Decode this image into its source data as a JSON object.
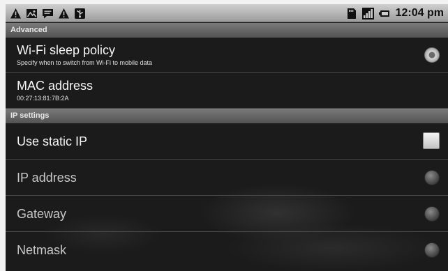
{
  "status_bar": {
    "left_icons": [
      "warning-icon",
      "image-icon",
      "message-icon",
      "warning-icon",
      "usb-icon"
    ],
    "right_icons": [
      "sd-card-icon",
      "signal-icon",
      "battery-icon"
    ],
    "time": "12:04 pm"
  },
  "advanced": {
    "header": "Advanced",
    "wifi_sleep_policy": {
      "title": "Wi-Fi sleep policy",
      "subtitle": "Specify when to switch from Wi-Fi to mobile data"
    },
    "mac_address": {
      "title": "MAC address",
      "value": "00:27:13:81:7B:2A"
    }
  },
  "ip_settings": {
    "header": "IP settings",
    "use_static_ip": {
      "title": "Use static IP",
      "checked": false
    },
    "items": [
      {
        "title": "IP address"
      },
      {
        "title": "Gateway"
      },
      {
        "title": "Netmask"
      }
    ]
  }
}
